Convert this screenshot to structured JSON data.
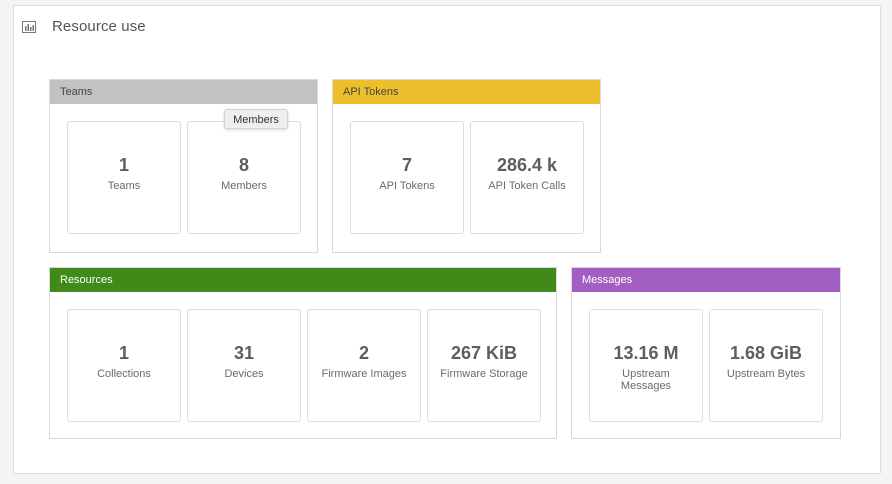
{
  "panel": {
    "title": "Resource use",
    "icon": "bar-chart-icon"
  },
  "tooltip": {
    "text": "Members"
  },
  "groups": {
    "teams": {
      "title": "Teams",
      "color": "#c2c2c2",
      "text_color": "#444444",
      "cards": [
        {
          "value": "1",
          "label": "Teams"
        },
        {
          "value": "8",
          "label": "Members"
        }
      ]
    },
    "api_tokens": {
      "title": "API Tokens",
      "color": "#eebf2c",
      "text_color": "#444444",
      "cards": [
        {
          "value": "7",
          "label": "API Tokens"
        },
        {
          "value": "286.4 k",
          "label": "API Token Calls"
        }
      ]
    },
    "resources": {
      "title": "Resources",
      "color": "#3f8a18",
      "text_color": "#ffffff",
      "cards": [
        {
          "value": "1",
          "label": "Collections"
        },
        {
          "value": "31",
          "label": "Devices"
        },
        {
          "value": "2",
          "label": "Firmware Images"
        },
        {
          "value": "267 KiB",
          "label": "Firmware Storage"
        }
      ]
    },
    "messages": {
      "title": "Messages",
      "color": "#a25ec1",
      "text_color": "#ffffff",
      "cards": [
        {
          "value": "13.16 M",
          "label": "Upstream Messages"
        },
        {
          "value": "1.68 GiB",
          "label": "Upstream Bytes"
        }
      ]
    }
  }
}
